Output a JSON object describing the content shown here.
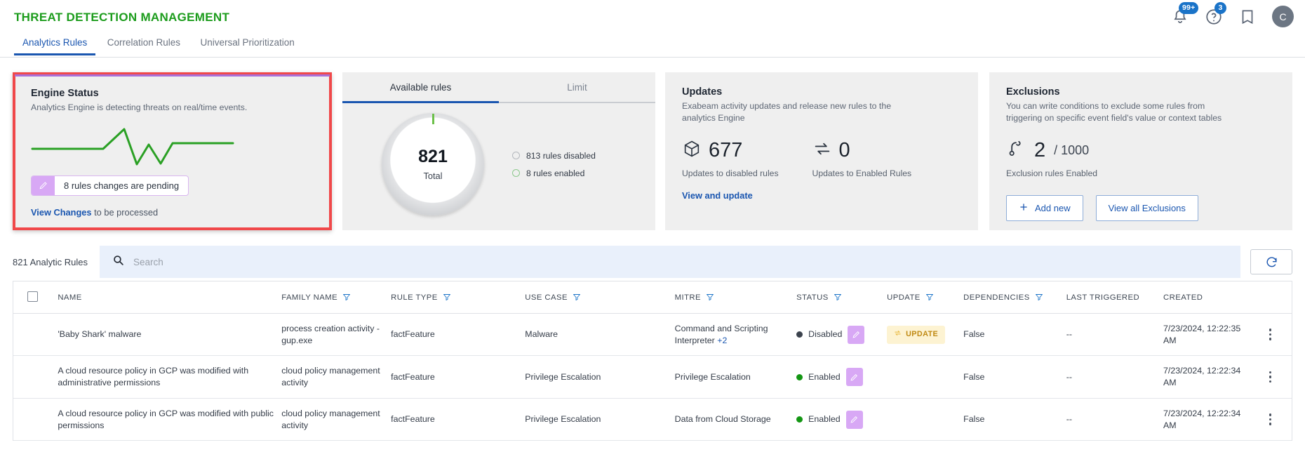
{
  "header": {
    "title": "THREAT DETECTION MANAGEMENT",
    "notifications_badge": "99+",
    "help_badge": "3",
    "avatar_initial": "C",
    "icons": [
      "bell-icon",
      "help-icon",
      "book-icon",
      "avatar"
    ]
  },
  "tabs": [
    {
      "label": "Analytics Rules",
      "active": true
    },
    {
      "label": "Correlation Rules",
      "active": false
    },
    {
      "label": "Universal Prioritization",
      "active": false
    }
  ],
  "engine_card": {
    "title": "Engine Status",
    "subtitle": "Analytics Engine is detecting threats on real/time events.",
    "pending_label": "8 rules changes are pending",
    "view_changes_link": "View Changes",
    "view_changes_rest": "to be processed",
    "highlight_color": "#f0484a",
    "spark_color": "#2aa024"
  },
  "rules_card": {
    "tabs": [
      {
        "label": "Available rules",
        "active": true
      },
      {
        "label": "Limit",
        "active": false
      }
    ],
    "total_value": "821",
    "total_label": "Total",
    "legend": [
      {
        "label": "813 rules disabled",
        "color": "#b4b8bd"
      },
      {
        "label": "8 rules enabled",
        "color": "#8dc98d"
      }
    ]
  },
  "updates_card": {
    "title": "Updates",
    "subtitle": "Exabeam activity updates and release new rules to the analytics Engine",
    "metrics": [
      {
        "icon": "cube-icon",
        "value": "677",
        "caption": "Updates to disabled rules"
      },
      {
        "icon": "sync-icon",
        "value": "0",
        "caption": "Updates to Enabled Rules"
      }
    ],
    "link": "View and update"
  },
  "exclusions_card": {
    "title": "Exclusions",
    "subtitle": "You can write conditions to exclude some rules from triggering on specific event field's value or context tables",
    "value": "2",
    "limit": "/ 1000",
    "caption": "Exclusion rules Enabled",
    "add_button": "Add new",
    "view_button": "View all Exclusions"
  },
  "toolbar": {
    "rule_count": "821 Analytic Rules",
    "search_placeholder": "Search",
    "search_value": "",
    "refresh_icon": "refresh-icon"
  },
  "table": {
    "columns": [
      {
        "label": "NAME",
        "filter": false
      },
      {
        "label": "FAMILY NAME",
        "filter": true
      },
      {
        "label": "RULE TYPE",
        "filter": true
      },
      {
        "label": "USE CASE",
        "filter": true
      },
      {
        "label": "MITRE",
        "filter": true
      },
      {
        "label": "STATUS",
        "filter": true
      },
      {
        "label": "UPDATE",
        "filter": true
      },
      {
        "label": "DEPENDENCIES",
        "filter": true
      },
      {
        "label": "LAST TRIGGERED",
        "filter": false
      },
      {
        "label": "CREATED",
        "filter": false
      }
    ],
    "rows": [
      {
        "name": "'Baby Shark' malware",
        "family_name": "process creation activity - gup.exe",
        "rule_type": "factFeature",
        "use_case": "Malware",
        "mitre": "Command and Scripting Interpreter",
        "mitre_more": "+2",
        "status": "Disabled",
        "status_state": "disabled",
        "update": "UPDATE",
        "dependencies": "False",
        "last_triggered": "--",
        "created": "7/23/2024, 12:22:35 AM"
      },
      {
        "name": "A cloud resource policy in GCP was modified with administrative permissions",
        "family_name": "cloud policy management activity",
        "rule_type": "factFeature",
        "use_case": "Privilege Escalation",
        "mitre": "Privilege Escalation",
        "mitre_more": "",
        "status": "Enabled",
        "status_state": "enabled",
        "update": "",
        "dependencies": "False",
        "last_triggered": "--",
        "created": "7/23/2024, 12:22:34 AM"
      },
      {
        "name": "A cloud resource policy in GCP was modified with public permissions",
        "family_name": "cloud policy management activity",
        "rule_type": "factFeature",
        "use_case": "Privilege Escalation",
        "mitre": "Data from Cloud Storage",
        "mitre_more": "",
        "status": "Enabled",
        "status_state": "enabled",
        "update": "",
        "dependencies": "False",
        "last_triggered": "--",
        "created": "7/23/2024, 12:22:34 AM"
      }
    ]
  }
}
